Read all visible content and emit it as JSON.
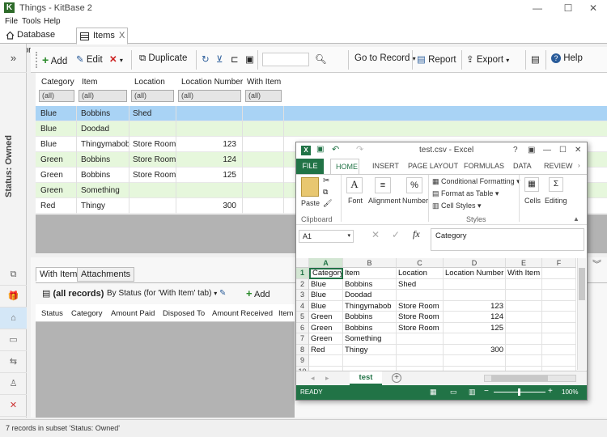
{
  "app": {
    "title": "Things - KitBase 2",
    "icon_letter": "K"
  },
  "window_controls": {
    "minimize": "—",
    "maximize": "☐",
    "close": "✕"
  },
  "menu": [
    "File",
    "Tools",
    "Help"
  ],
  "doc_tabs": {
    "home": "Database Home",
    "items": "Items",
    "close": "X"
  },
  "sidebar": {
    "collapse": "»",
    "status_label": "Status: Owned"
  },
  "toolbar": {
    "add": "Add",
    "edit": "Edit",
    "duplicate": "Duplicate",
    "goto": "Go to Record",
    "report": "Report",
    "export": "Export",
    "help": "Help",
    "search_placeholder": ""
  },
  "grid": {
    "columns": [
      "Category",
      "Item",
      "Location",
      "Location Number",
      "With Item"
    ],
    "filters": [
      "(all)",
      "(all)",
      "(all)",
      "(all)",
      "(all)"
    ],
    "rows": [
      {
        "category": "Blue",
        "item": "Bobbins",
        "location": "Shed",
        "number": "",
        "with": ""
      },
      {
        "category": "Blue",
        "item": "Doodad",
        "location": "",
        "number": "",
        "with": ""
      },
      {
        "category": "Blue",
        "item": "Thingymabob",
        "location": "Store Room",
        "number": "123",
        "with": ""
      },
      {
        "category": "Green",
        "item": "Bobbins",
        "location": "Store Room",
        "number": "124",
        "with": ""
      },
      {
        "category": "Green",
        "item": "Bobbins",
        "location": "Store Room",
        "number": "125",
        "with": ""
      },
      {
        "category": "Green",
        "item": "Something",
        "location": "",
        "number": "",
        "with": ""
      },
      {
        "category": "Red",
        "item": "Thingy",
        "location": "",
        "number": "300",
        "with": ""
      }
    ]
  },
  "bottom": {
    "tabs": [
      "With Item",
      "Attachments"
    ],
    "records": "(all records)",
    "view": "By Status (for 'With Item' tab)",
    "add": "Add",
    "columns": [
      "Status",
      "Category",
      "Amount Paid",
      "Disposed To",
      "Amount Received",
      "Item"
    ]
  },
  "statusbar": {
    "text": "7 records in subset 'Status: Owned'"
  },
  "excel": {
    "title": "test.csv - Excel",
    "controls": [
      "?",
      "▣",
      "—",
      "☐",
      "✕"
    ],
    "ribbon_tabs": [
      "FILE",
      "HOME",
      "INSERT",
      "PAGE LAYOUT",
      "FORMULAS",
      "DATA",
      "REVIEW"
    ],
    "groups": {
      "clipboard": "Clipboard",
      "paste": "Paste",
      "font": "Font",
      "alignment": "Alignment",
      "number": "Number",
      "cond_format": "Conditional Formatting",
      "format_table": "Format as Table",
      "cell_styles": "Cell Styles",
      "styles": "Styles",
      "cells": "Cells",
      "editing": "Editing"
    },
    "namebox": "A1",
    "formula": "Category",
    "col_headers": [
      "A",
      "B",
      "C",
      "D",
      "E",
      "F"
    ],
    "row_headers": [
      "1",
      "2",
      "3",
      "4",
      "5",
      "6",
      "7",
      "8",
      "9",
      "10"
    ],
    "cells": [
      [
        "Category",
        "Item",
        "Location",
        "Location Number",
        "With Item"
      ],
      [
        "Blue",
        "Bobbins",
        "Shed",
        "",
        ""
      ],
      [
        "Blue",
        "Doodad",
        "",
        "",
        ""
      ],
      [
        "Blue",
        "Thingymabob",
        "Store Room",
        "123",
        ""
      ],
      [
        "Green",
        "Bobbins",
        "Store Room",
        "124",
        ""
      ],
      [
        "Green",
        "Bobbins",
        "Store Room",
        "125",
        ""
      ],
      [
        "Green",
        "Something",
        "",
        "",
        ""
      ],
      [
        "Red",
        "Thingy",
        "",
        "300",
        ""
      ]
    ],
    "sheet_tab": "test",
    "status": "READY",
    "zoom": "100%"
  },
  "colors": {
    "selected_row": "#a9d3f5",
    "alt_row": "#e6f7dc",
    "excel_green": "#217346"
  }
}
